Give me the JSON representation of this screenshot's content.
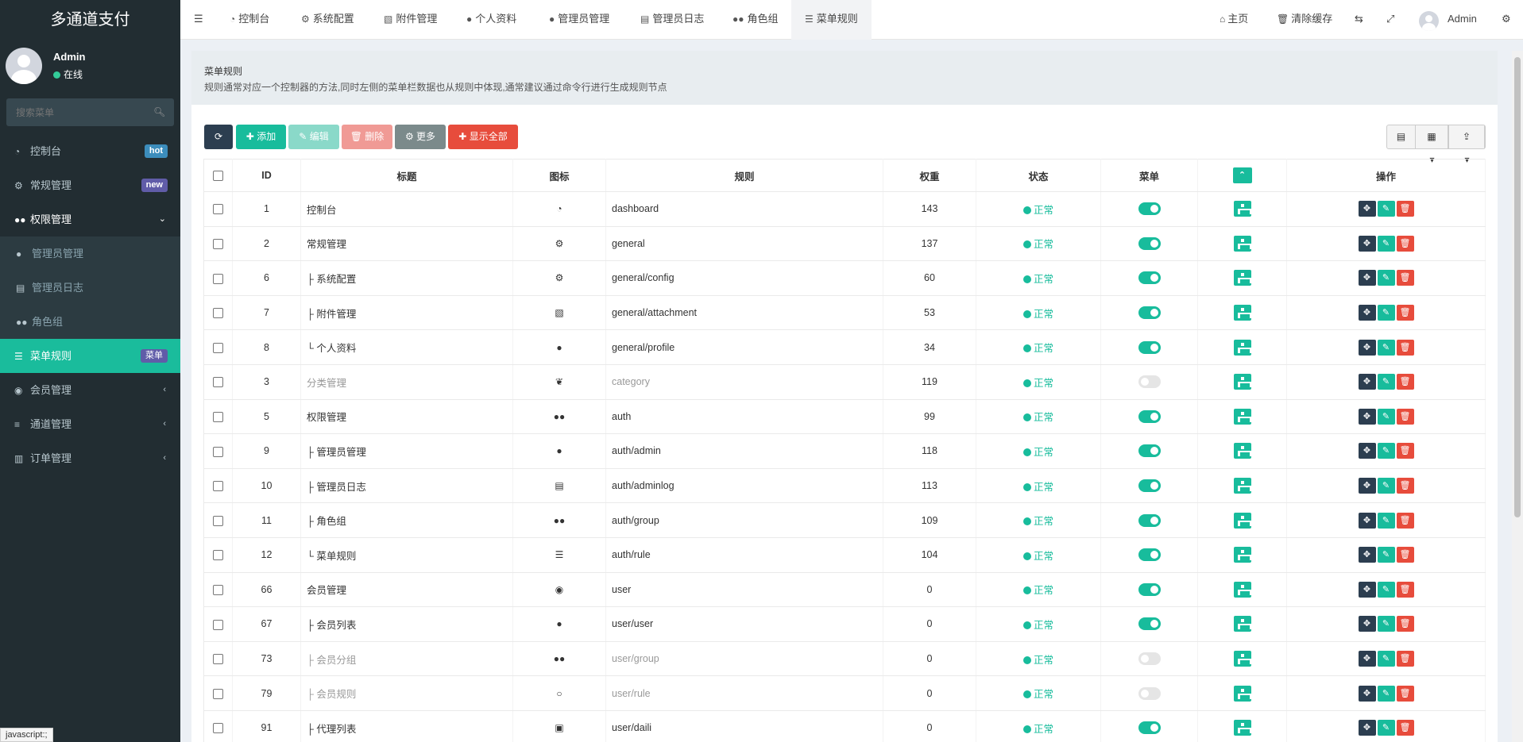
{
  "sidebar": {
    "logo": "多通道支付",
    "user": {
      "name": "Admin",
      "status": "在线"
    },
    "search_placeholder": "搜索菜单",
    "items": [
      {
        "label": "控制台",
        "icon": "dashboard-icon",
        "badge": "hot"
      },
      {
        "label": "常规管理",
        "icon": "cogs-icon",
        "badge": "new"
      },
      {
        "label": "权限管理",
        "icon": "group-icon",
        "chevron": "⌄"
      },
      {
        "label": "管理员管理",
        "icon": "user-icon"
      },
      {
        "label": "管理员日志",
        "icon": "list-alt-icon"
      },
      {
        "label": "角色组",
        "icon": "group-icon"
      },
      {
        "label": "菜单规则",
        "icon": "bars-icon",
        "badge": "菜单"
      },
      {
        "label": "会员管理",
        "icon": "user-circle-icon",
        "chevron": "‹"
      },
      {
        "label": "通道管理",
        "icon": "align-left-icon",
        "chevron": "‹"
      },
      {
        "label": "订单管理",
        "icon": "bar-chart-icon",
        "chevron": "‹"
      }
    ]
  },
  "topnav": {
    "tabs": [
      {
        "label": "控制台",
        "icon": "dashboard-icon"
      },
      {
        "label": "系统配置",
        "icon": "cog-icon"
      },
      {
        "label": "附件管理",
        "icon": "file-image-icon"
      },
      {
        "label": "个人资料",
        "icon": "user-icon"
      },
      {
        "label": "管理员管理",
        "icon": "user-icon"
      },
      {
        "label": "管理员日志",
        "icon": "list-alt-icon"
      },
      {
        "label": "角色组",
        "icon": "group-icon"
      },
      {
        "label": "菜单规则",
        "icon": "bars-icon"
      }
    ],
    "home": "主页",
    "clear_cache": "清除缓存",
    "user": "Admin"
  },
  "content": {
    "title": "菜单规则",
    "description": "规则通常对应一个控制器的方法,同时左侧的菜单栏数据也从规则中体现,通常建议通过命令行进行生成规则节点"
  },
  "toolbar": {
    "add": "添加",
    "edit": "编辑",
    "delete": "删除",
    "more": "更多",
    "show_all": "显示全部"
  },
  "table": {
    "headers": [
      "ID",
      "标题",
      "图标",
      "规则",
      "权重",
      "状态",
      "菜单",
      "操作"
    ],
    "rows": [
      {
        "id": "1",
        "title": "控制台",
        "icon": "dashboard-icon",
        "rule": "dashboard",
        "weight": "143",
        "status": "正常",
        "menu": true
      },
      {
        "id": "2",
        "title": "常规管理",
        "icon": "cogs-icon",
        "rule": "general",
        "weight": "137",
        "status": "正常",
        "menu": true
      },
      {
        "id": "6",
        "title": "├ 系统配置",
        "icon": "cog-icon",
        "rule": "general/config",
        "weight": "60",
        "status": "正常",
        "menu": true
      },
      {
        "id": "7",
        "title": "├ 附件管理",
        "icon": "file-image-icon",
        "rule": "general/attachment",
        "weight": "53",
        "status": "正常",
        "menu": true
      },
      {
        "id": "8",
        "title": "└ 个人资料",
        "icon": "user-icon",
        "rule": "general/profile",
        "weight": "34",
        "status": "正常",
        "menu": true
      },
      {
        "id": "3",
        "title": "分类管理",
        "icon": "leaf-icon",
        "rule": "category",
        "weight": "119",
        "status": "正常",
        "menu": false
      },
      {
        "id": "5",
        "title": "权限管理",
        "icon": "group-icon",
        "rule": "auth",
        "weight": "99",
        "status": "正常",
        "menu": true
      },
      {
        "id": "9",
        "title": "├ 管理员管理",
        "icon": "user-icon",
        "rule": "auth/admin",
        "weight": "118",
        "status": "正常",
        "menu": true
      },
      {
        "id": "10",
        "title": "├ 管理员日志",
        "icon": "list-alt-icon",
        "rule": "auth/adminlog",
        "weight": "113",
        "status": "正常",
        "menu": true
      },
      {
        "id": "11",
        "title": "├ 角色组",
        "icon": "group-icon",
        "rule": "auth/group",
        "weight": "109",
        "status": "正常",
        "menu": true
      },
      {
        "id": "12",
        "title": "└ 菜单规则",
        "icon": "bars-icon",
        "rule": "auth/rule",
        "weight": "104",
        "status": "正常",
        "menu": true
      },
      {
        "id": "66",
        "title": "会员管理",
        "icon": "user-circle-icon",
        "rule": "user",
        "weight": "0",
        "status": "正常",
        "menu": true
      },
      {
        "id": "67",
        "title": "├ 会员列表",
        "icon": "user-icon",
        "rule": "user/user",
        "weight": "0",
        "status": "正常",
        "menu": true
      },
      {
        "id": "73",
        "title": "├ 会员分组",
        "icon": "group-icon",
        "rule": "user/group",
        "weight": "0",
        "status": "正常",
        "menu": false
      },
      {
        "id": "79",
        "title": "├ 会员规则",
        "icon": "circle-o-icon",
        "rule": "user/rule",
        "weight": "0",
        "status": "正常",
        "menu": false
      },
      {
        "id": "91",
        "title": "├ 代理列表",
        "icon": "id-card-icon",
        "rule": "user/daili",
        "weight": "0",
        "status": "正常",
        "menu": true
      }
    ]
  },
  "statusbar": "javascript:;"
}
